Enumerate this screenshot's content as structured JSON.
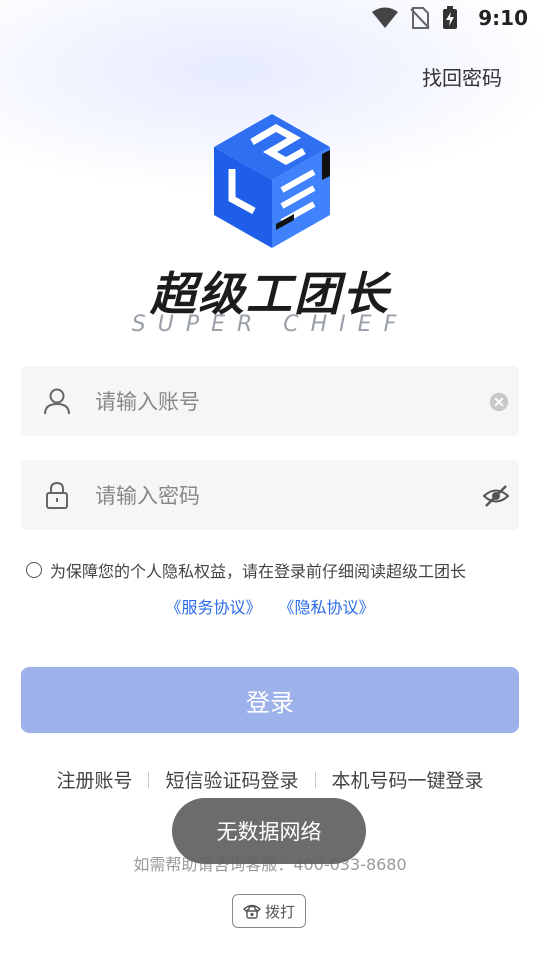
{
  "status_bar": {
    "time": "9:10",
    "icons": [
      "wifi-icon",
      "no-sim-icon",
      "battery-charging-icon"
    ]
  },
  "header": {
    "forgot_password": "找回密码"
  },
  "logo": {
    "name_cn": "超级工团长",
    "name_en": "SUPER CHIEF",
    "colors": {
      "primary": "#2b6cf0",
      "dark": "#1c1c1c"
    }
  },
  "form": {
    "account": {
      "placeholder": "请输入账号",
      "value": "",
      "icon": "user-icon",
      "clear_icon": "clear-icon"
    },
    "password": {
      "placeholder": "请输入密码",
      "value": "",
      "icon": "lock-icon",
      "toggle_icon": "eye-off-icon"
    }
  },
  "agreement": {
    "text": "为保障您的个人隐私权益，请在登录前仔细阅读超级工团长",
    "service_link": "《服务协议》",
    "privacy_link": "《隐私协议》",
    "checked": false
  },
  "login_button": {
    "label": "登录",
    "color": "#9db2eb"
  },
  "alt_login": {
    "register": "注册账号",
    "sms_login": "短信验证码登录",
    "one_click_login": "本机号码一键登录"
  },
  "help": {
    "text": "如需帮助请咨询客服：400-033-8680",
    "dial_label": "拨打",
    "dial_icon": "phone-icon"
  },
  "toast": {
    "message": "无数据网络"
  }
}
